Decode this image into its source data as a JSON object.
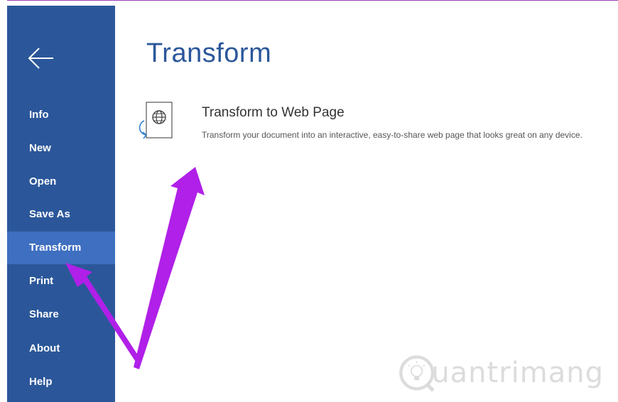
{
  "sidebar": {
    "back_icon": "back-arrow-icon",
    "items": [
      {
        "label": "Info",
        "selected": false
      },
      {
        "label": "New",
        "selected": false
      },
      {
        "label": "Open",
        "selected": false
      },
      {
        "label": "Save As",
        "selected": false
      },
      {
        "label": "Transform",
        "selected": true
      },
      {
        "label": "Print",
        "selected": false
      },
      {
        "label": "Share",
        "selected": false
      },
      {
        "label": "About",
        "selected": false
      },
      {
        "label": "Help",
        "selected": false
      }
    ]
  },
  "main": {
    "title": "Transform",
    "option": {
      "icon": "web-page-globe-icon",
      "title": "Transform to Web Page",
      "description": "Transform your document into an interactive, easy-to-share web page that looks great on any device."
    }
  },
  "watermark": {
    "text": "uantrimang"
  },
  "colors": {
    "sidebar_bg": "#2b579a",
    "sidebar_selected": "#3e6fc1",
    "title_blue": "#2b579a",
    "annotation_arrow": "#b020e8"
  }
}
